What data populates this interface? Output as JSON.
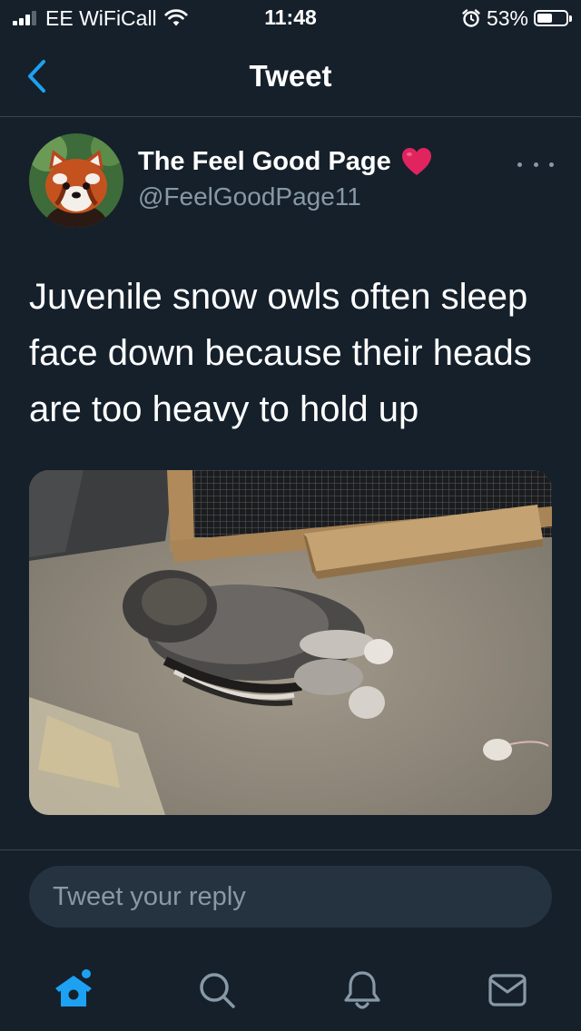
{
  "status_bar": {
    "carrier": "EE WiFiCall",
    "time": "11:48",
    "battery_percent": "53%",
    "battery_level": 0.53,
    "signal_bars_active": 3,
    "signal_bars_total": 4,
    "icons": [
      "signal-icon",
      "wifi-icon",
      "alarm-icon",
      "battery-icon"
    ]
  },
  "nav": {
    "title": "Tweet",
    "back_icon": "chevron-left-icon"
  },
  "tweet": {
    "author_name": "The Feel Good Page",
    "author_emoji_icon": "heart-icon",
    "author_handle": "@FeelGoodPage11",
    "more_icon": "more-dots-icon",
    "text": "Juvenile snow owls often sleep face down because their heads are too heavy to hold up",
    "media": "photo of a juvenile owl sleeping face down on sand"
  },
  "reply": {
    "placeholder": "Tweet your reply"
  },
  "tab_bar": {
    "tabs": [
      {
        "name": "home",
        "icon": "home-icon",
        "active": true
      },
      {
        "name": "search",
        "icon": "search-icon",
        "active": false
      },
      {
        "name": "notifications",
        "icon": "bell-icon",
        "active": false
      },
      {
        "name": "messages",
        "icon": "mail-icon",
        "active": false
      }
    ]
  },
  "colors": {
    "background": "#15202b",
    "accent": "#1da1f2",
    "muted_text": "#8899a6",
    "divider": "#38444d",
    "reply_bg": "#253341",
    "heart": "#e0245e"
  }
}
